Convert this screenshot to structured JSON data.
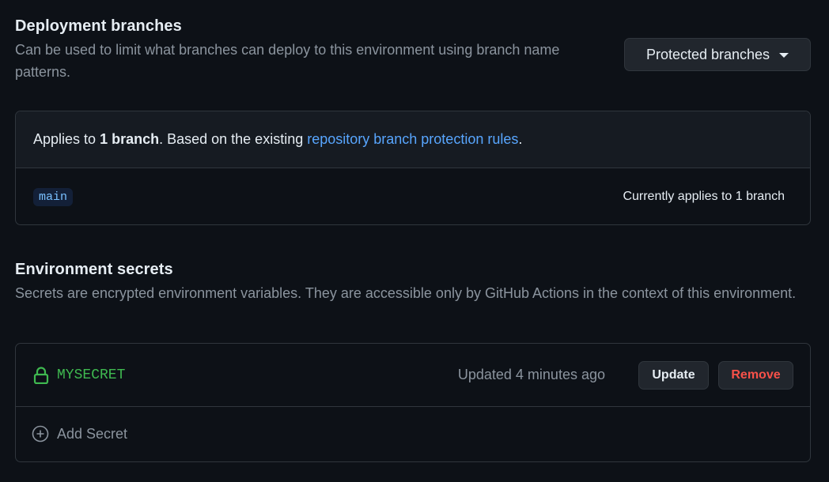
{
  "deployment_branches": {
    "title": "Deployment branches",
    "description": "Can be used to limit what branches can deploy to this environment using branch name patterns.",
    "dropdown_label": "Protected branches",
    "info": {
      "prefix": "Applies to ",
      "count_text": "1 branch",
      "middle": ". Based on the existing ",
      "link_text": "repository branch protection rules",
      "suffix": "."
    },
    "branch": "main",
    "applies_text": "Currently applies to 1 branch"
  },
  "environment_secrets": {
    "title": "Environment secrets",
    "description": "Secrets are encrypted environment variables. They are accessible only by GitHub Actions in the context of this environment.",
    "secrets": [
      {
        "name": "MYSECRET",
        "updated": "Updated 4 minutes ago",
        "update_label": "Update",
        "remove_label": "Remove"
      }
    ],
    "add_label": "Add Secret"
  },
  "icons": {
    "lock": "lock-icon",
    "add": "plus-circle-icon",
    "caret": "caret-down-icon"
  },
  "colors": {
    "background": "#0d1117",
    "link": "#58a6ff",
    "secret_name": "#3fb950",
    "danger": "#f85149"
  }
}
